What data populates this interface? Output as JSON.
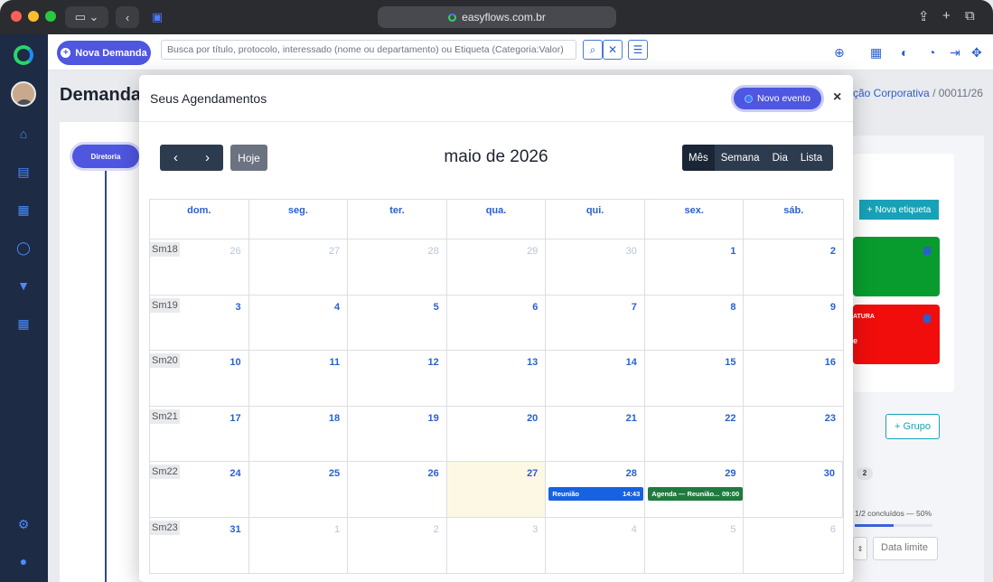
{
  "browser": {
    "url": "easyflows.com.br"
  },
  "topbar": {
    "new_demand_label": "Nova Demanda",
    "search_placeholder": "Busca por título, protocolo, interessado (nome ou departamento) ou Etiqueta (Categoria:Valor)"
  },
  "page": {
    "title": "Demanda",
    "breadcrumb_link": "ção Corporativa",
    "breadcrumb_sep": "/",
    "breadcrumb_current": "00011/26",
    "tree_root": "Diretoria",
    "new_tag_label": "Nova etiqueta",
    "tag_red_label": "ATURA",
    "tag_red_mini": "e",
    "group_button": "+ Grupo",
    "badge_count": "2",
    "progress_text": "1/2 concluídos — 50%",
    "progress_fraction": 0.5,
    "due_date_placeholder": "Data limite"
  },
  "modal": {
    "title": "Seus Agendamentos",
    "new_event_label": "Novo evento",
    "close": "×",
    "today_label": "Hoje",
    "month_title": "maio de 2026",
    "views": [
      "Mês",
      "Semana",
      "Dia",
      "Lista"
    ],
    "active_view": "Mês"
  },
  "calendar": {
    "weekdays": [
      "dom.",
      "seg.",
      "ter.",
      "qua.",
      "qui.",
      "sex.",
      "sáb."
    ],
    "weeks": [
      {
        "label": "Sm18",
        "days": [
          {
            "n": "26",
            "other": true
          },
          {
            "n": "27",
            "other": true
          },
          {
            "n": "28",
            "other": true
          },
          {
            "n": "29",
            "other": true
          },
          {
            "n": "30",
            "other": true
          },
          {
            "n": "1"
          },
          {
            "n": "2"
          }
        ]
      },
      {
        "label": "Sm19",
        "days": [
          {
            "n": "3"
          },
          {
            "n": "4"
          },
          {
            "n": "5"
          },
          {
            "n": "6"
          },
          {
            "n": "7"
          },
          {
            "n": "8"
          },
          {
            "n": "9"
          }
        ]
      },
      {
        "label": "Sm20",
        "days": [
          {
            "n": "10"
          },
          {
            "n": "11"
          },
          {
            "n": "12"
          },
          {
            "n": "13"
          },
          {
            "n": "14"
          },
          {
            "n": "15"
          },
          {
            "n": "16"
          }
        ]
      },
      {
        "label": "Sm21",
        "days": [
          {
            "n": "17"
          },
          {
            "n": "18"
          },
          {
            "n": "19"
          },
          {
            "n": "20"
          },
          {
            "n": "21"
          },
          {
            "n": "22"
          },
          {
            "n": "23"
          }
        ]
      },
      {
        "label": "Sm22",
        "days": [
          {
            "n": "24"
          },
          {
            "n": "25"
          },
          {
            "n": "26"
          },
          {
            "n": "27",
            "today": true
          },
          {
            "n": "28"
          },
          {
            "n": "29"
          },
          {
            "n": "30"
          }
        ]
      },
      {
        "label": "Sm23",
        "days": [
          {
            "n": "31"
          },
          {
            "n": "1",
            "other": true
          },
          {
            "n": "2",
            "other": true
          },
          {
            "n": "3",
            "other": true
          },
          {
            "n": "4",
            "other": true
          },
          {
            "n": "5",
            "other": true
          },
          {
            "n": "6",
            "other": true
          }
        ]
      }
    ],
    "events": [
      {
        "title": "Reunião",
        "time": "14:43",
        "week": 4,
        "day": 4,
        "color": "blue"
      },
      {
        "title": "Agenda — Reunião...",
        "time": "09:00",
        "week": 4,
        "day": 5,
        "color": "green"
      }
    ]
  },
  "colors": {
    "accent": "#4f56e0",
    "sidebar": "#1d2b44",
    "today": "#fcf8e3"
  }
}
